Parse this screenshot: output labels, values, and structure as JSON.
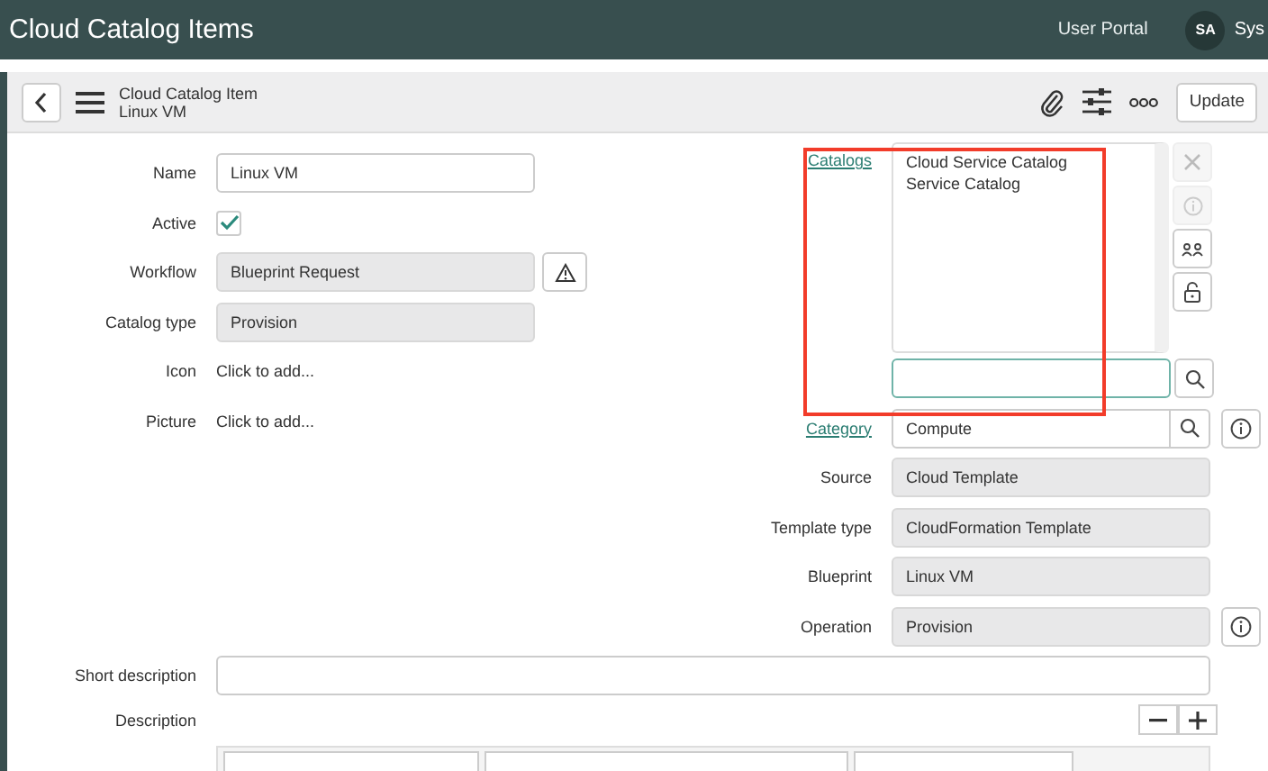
{
  "header": {
    "title": "Cloud Catalog Items",
    "portal_link": "User Portal",
    "avatar": "SA",
    "user": "Sys"
  },
  "form_header": {
    "title": "Cloud Catalog Item",
    "subtitle": "Linux VM",
    "update_button": "Update"
  },
  "left_fields": [
    {
      "label": "Name",
      "kind": "text",
      "value": "Linux VM"
    },
    {
      "label": "Active",
      "kind": "checkbox",
      "checked": true
    },
    {
      "label": "Workflow",
      "kind": "readonly_warning",
      "value": "Blueprint Request"
    },
    {
      "label": "Catalog type",
      "kind": "readonly",
      "value": "Provision"
    },
    {
      "label": "Icon",
      "kind": "attachment",
      "value": "Click to add..."
    },
    {
      "label": "Picture",
      "kind": "attachment",
      "value": "Click to add..."
    }
  ],
  "catalogs": {
    "label": "Catalogs",
    "items": [
      "Cloud Service Catalog",
      "Service Catalog"
    ]
  },
  "right_fields": [
    {
      "label": "Category",
      "kind": "lookup",
      "value": "Compute"
    },
    {
      "label": "Source",
      "kind": "readonly",
      "value": "Cloud Template"
    },
    {
      "label": "Template type",
      "kind": "readonly",
      "value": "CloudFormation Template"
    },
    {
      "label": "Blueprint",
      "kind": "readonly",
      "value": "Linux VM"
    },
    {
      "label": "Operation",
      "kind": "readonly_info",
      "value": "Provision"
    }
  ],
  "short_description": {
    "label": "Short description"
  },
  "description": {
    "label": "Description"
  }
}
